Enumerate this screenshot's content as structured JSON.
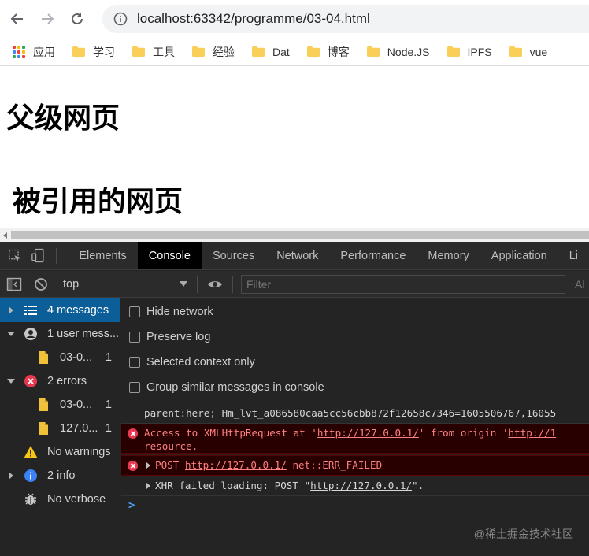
{
  "browser": {
    "url": "localhost:63342/programme/03-04.html",
    "bookmarks": [
      {
        "label": "应用",
        "type": "apps"
      },
      {
        "label": "学习",
        "type": "folder"
      },
      {
        "label": "工具",
        "type": "folder"
      },
      {
        "label": "经验",
        "type": "folder"
      },
      {
        "label": "Dat",
        "type": "folder"
      },
      {
        "label": "博客",
        "type": "folder"
      },
      {
        "label": "Node.JS",
        "type": "folder"
      },
      {
        "label": "IPFS",
        "type": "folder"
      },
      {
        "label": "vue",
        "type": "folder"
      }
    ]
  },
  "page": {
    "parent_heading": "父级网页",
    "child_heading": "被引用的网页"
  },
  "devtools": {
    "tabs": [
      "Elements",
      "Console",
      "Sources",
      "Network",
      "Performance",
      "Memory",
      "Application",
      "Li"
    ],
    "active_tab": "Console",
    "context": "top",
    "filter_placeholder": "Filter",
    "toolbar_tail": "Al",
    "sidebar": [
      {
        "label": "4 messages",
        "icon": "list-icon",
        "count": "",
        "tri": "right",
        "indent": 0
      },
      {
        "label": "1 user mess...",
        "icon": "user-icon",
        "count": "",
        "tri": "down",
        "indent": 0
      },
      {
        "label": "03-0...",
        "icon": "file-icon",
        "count": "1",
        "tri": "",
        "indent": 1
      },
      {
        "label": "2 errors",
        "icon": "error-icon",
        "count": "",
        "tri": "down",
        "indent": 0
      },
      {
        "label": "03-0...",
        "icon": "file-icon",
        "count": "1",
        "tri": "",
        "indent": 1
      },
      {
        "label": "127.0...",
        "icon": "file-icon",
        "count": "1",
        "tri": "",
        "indent": 1
      },
      {
        "label": "No warnings",
        "icon": "warning-icon",
        "count": "",
        "tri": "",
        "indent": 0
      },
      {
        "label": "2 info",
        "icon": "info-icon",
        "count": "",
        "tri": "right",
        "indent": 0
      },
      {
        "label": "No verbose",
        "icon": "bug-icon",
        "count": "",
        "tri": "",
        "indent": 0
      }
    ],
    "options": [
      "Hide network",
      "Preserve log",
      "Selected context only",
      "Group similar messages in console"
    ],
    "logs": {
      "parent_line": "parent:here; Hm_lvt_a086580caa5cc56cbb872f12658c7346=1605506767,16055",
      "cors_prefix": "Access to XMLHttpRequest at '",
      "cors_link": "http://127.0.0.1/",
      "cors_middle": "' from origin '",
      "cors_link2": "http://1",
      "cors_line2": "resource.",
      "post_method": "POST",
      "post_link": "http://127.0.0.1/",
      "post_err": "net::ERR_FAILED",
      "xhr_prefix": "XHR failed loading: POST \"",
      "xhr_link": "http://127.0.0.1/",
      "xhr_suffix": "\"."
    },
    "prompt": ">"
  },
  "watermark": "@稀土掘金技术社区"
}
